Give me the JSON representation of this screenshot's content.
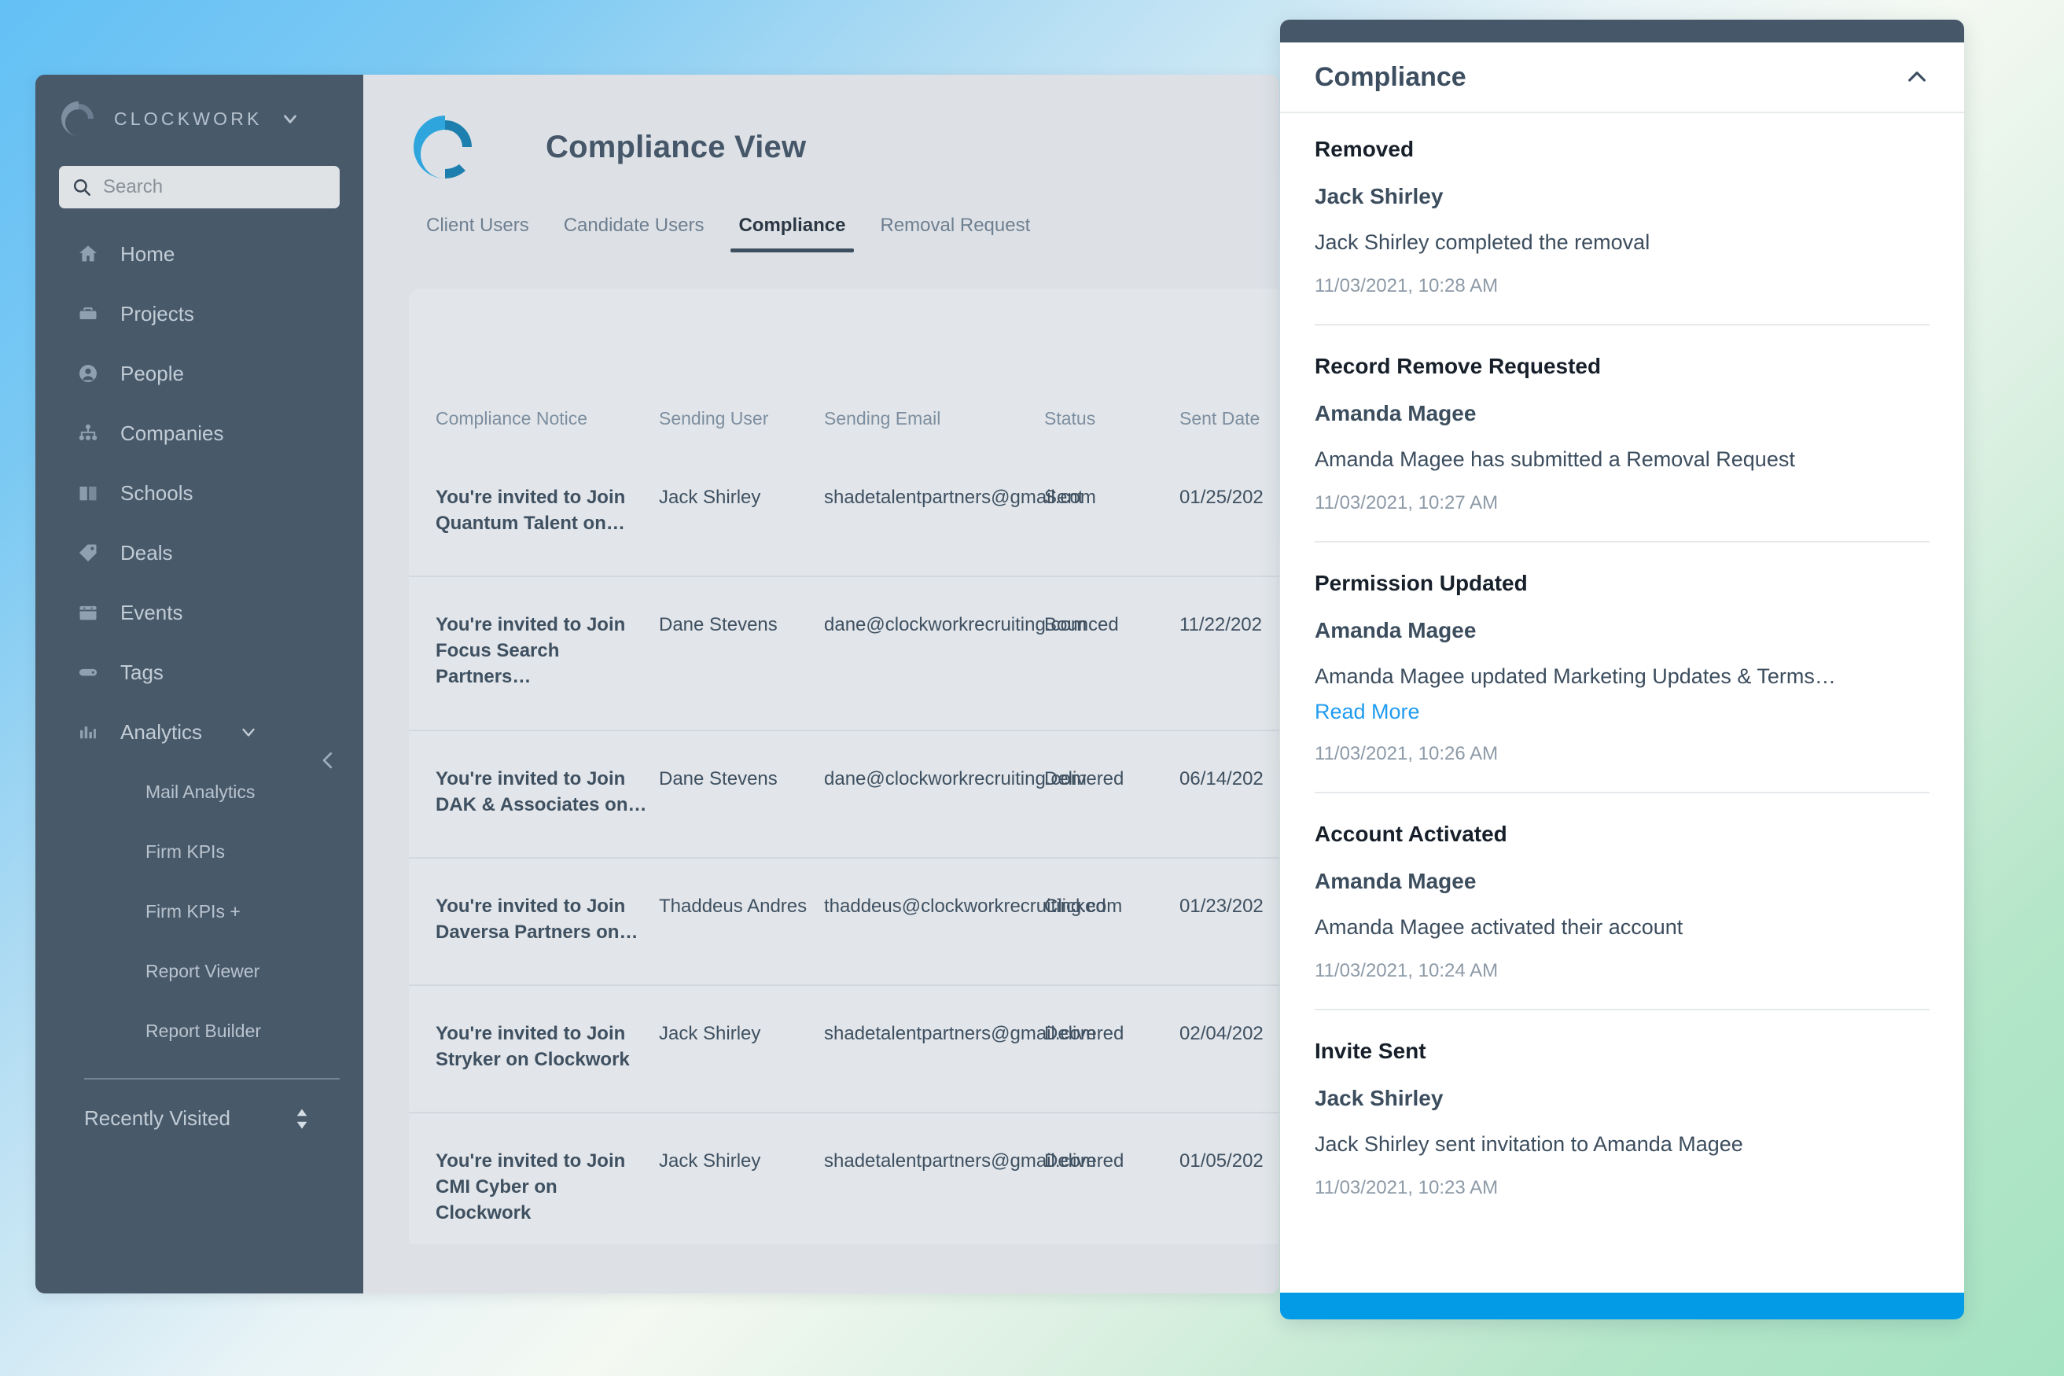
{
  "sidebar": {
    "brand": "CLOCKWORK",
    "brand_caret_icon": "chevron-down-icon",
    "search": {
      "placeholder": "Search",
      "value": "",
      "icon": "search-icon"
    },
    "nav_items": [
      {
        "label": "Home",
        "icon": "home-icon"
      },
      {
        "label": "Projects",
        "icon": "briefcase-icon"
      },
      {
        "label": "People",
        "icon": "person-circle-icon"
      },
      {
        "label": "Companies",
        "icon": "org-chart-icon"
      },
      {
        "label": "Schools",
        "icon": "book-icon"
      },
      {
        "label": "Deals",
        "icon": "tag-icon"
      },
      {
        "label": "Events",
        "icon": "calendar-icon"
      },
      {
        "label": "Tags",
        "icon": "label-icon"
      },
      {
        "label": "Analytics",
        "icon": "bar-chart-icon",
        "caret_icon": "chevron-down-icon"
      }
    ],
    "analytics_children": [
      {
        "label": "Mail Analytics"
      },
      {
        "label": "Firm KPIs"
      },
      {
        "label": "Firm KPIs +"
      },
      {
        "label": "Report Viewer"
      },
      {
        "label": "Report Builder"
      }
    ],
    "recently_visited": {
      "label": "Recently Visited",
      "icon": "sort-updown-icon"
    },
    "collapse_icon": "chevron-left-icon"
  },
  "main": {
    "page_title": "Compliance View",
    "logo_icon": "clockwork-c-logo",
    "tabs": [
      {
        "label": "Client Users",
        "active": false
      },
      {
        "label": "Candidate Users",
        "active": false
      },
      {
        "label": "Compliance",
        "active": true
      },
      {
        "label": "Removal Request",
        "active": false
      }
    ],
    "table": {
      "columns": [
        "Compliance Notice",
        "Sending User",
        "Sending Email",
        "Status",
        "Sent Date"
      ],
      "rows": [
        {
          "notice": "You're invited to Join Quantum Talent on…",
          "user": "Jack Shirley",
          "email": "shadetalentpartners@gmail.com",
          "status": "Sent",
          "sent_date": "01/25/202"
        },
        {
          "notice": "You're invited to Join Focus Search Partners…",
          "user": "Dane Stevens",
          "email": "dane@clockworkrecruiting.com",
          "status": "Bounced",
          "sent_date": "11/22/202"
        },
        {
          "notice": "You're invited to Join DAK & Associates on…",
          "user": "Dane Stevens",
          "email": "dane@clockworkrecruiting.com",
          "status": "Delivered",
          "sent_date": "06/14/202"
        },
        {
          "notice": "You're invited to Join Daversa Partners on…",
          "user": "Thaddeus Andres",
          "email": "thaddeus@clockworkrecruiting.com",
          "status": "Clicked",
          "sent_date": "01/23/202"
        },
        {
          "notice": "You're invited to Join Stryker on Clockwork",
          "user": "Jack Shirley",
          "email": "shadetalentpartners@gmail.com",
          "status": "Delivered",
          "sent_date": "02/04/202"
        },
        {
          "notice": "You're invited to Join CMI Cyber on Clockwork",
          "user": "Jack Shirley",
          "email": "shadetalentpartners@gmail.com",
          "status": "Delivered",
          "sent_date": "01/05/202"
        }
      ]
    }
  },
  "panel": {
    "title": "Compliance",
    "collapse_icon": "chevron-up-icon",
    "entries": [
      {
        "type": "Removed",
        "name": "Jack Shirley",
        "description": "Jack Shirley completed the removal",
        "timestamp": "11/03/2021, 10:28 AM"
      },
      {
        "type": "Record Remove Requested",
        "name": "Amanda Magee",
        "description": "Amanda Magee has submitted a Removal Request",
        "timestamp": "11/03/2021, 10:27 AM"
      },
      {
        "type": "Permission Updated",
        "name": "Amanda Magee",
        "description": "Amanda Magee updated Marketing Updates & Terms…",
        "read_more": "Read More",
        "timestamp": "11/03/2021, 10:26 AM"
      },
      {
        "type": "Account Activated",
        "name": "Amanda Magee",
        "description": "Amanda Magee activated their account",
        "timestamp": "11/03/2021, 10:24 AM"
      },
      {
        "type": "Invite Sent",
        "name": "Jack Shirley",
        "description": "Jack Shirley sent invitation to Amanda Magee",
        "timestamp": "11/03/2021, 10:23 AM"
      }
    ]
  },
  "colors": {
    "sidebar_bg": "#48596a",
    "main_bg": "#dde1e6",
    "card_bg": "#e2e6ea",
    "accent_blue": "#039be5",
    "link_blue": "#1f9bf0",
    "panel_topbar": "#46576a",
    "text_dark": "#3c4d5e"
  }
}
